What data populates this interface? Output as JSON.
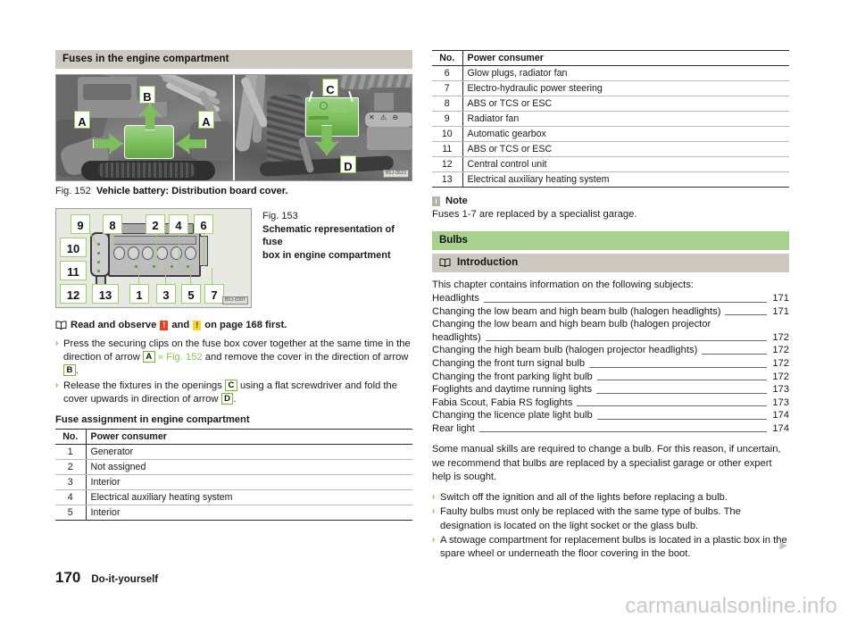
{
  "document": {
    "page_number": "170",
    "section_name": "Do-it-yourself",
    "watermark": "carmanualsonline.info",
    "continuation_marker": "▶"
  },
  "left_column": {
    "section_heading": "Fuses in the engine compartment",
    "figure_152": {
      "label": "Fig. 152",
      "caption": "Vehicle battery: Distribution board cover.",
      "image_code": "B5J-0523",
      "callouts": [
        "A",
        "B",
        "A",
        "C",
        "D"
      ]
    },
    "figure_153": {
      "label": "Fig. 153",
      "caption_line1": "Schematic representation of fuse",
      "caption_line2": "box in engine compartment",
      "image_code": "B5J-0397",
      "top_numbers": [
        "9",
        "8",
        "2",
        "4",
        "6"
      ],
      "left_numbers": [
        "10",
        "11"
      ],
      "bottom_numbers": [
        "12",
        "13",
        "1",
        "3",
        "5",
        "7"
      ]
    },
    "read_observe": {
      "prefix": "Read and observe",
      "middle": "and",
      "suffix": "on page 168 first.",
      "warning_red": "!",
      "warning_yellow": "!",
      "book_icon": "book-icon"
    },
    "bullets": [
      {
        "parts": [
          {
            "type": "text",
            "value": "Press the securing clips on the fuse box cover together at the same time in the direction of arrow "
          },
          {
            "type": "tag",
            "value": "A"
          },
          {
            "type": "xref",
            "value": " » Fig. 152 "
          },
          {
            "type": "text",
            "value": "and remove the cover in the direction of arrow "
          },
          {
            "type": "tag",
            "value": "B"
          },
          {
            "type": "text",
            "value": "."
          }
        ]
      },
      {
        "parts": [
          {
            "type": "text",
            "value": "Release the fixtures in the openings "
          },
          {
            "type": "tag",
            "value": "C"
          },
          {
            "type": "text",
            "value": " using a flat screwdriver and fold the cover upwards in direction of arrow "
          },
          {
            "type": "tag",
            "value": "D"
          },
          {
            "type": "text",
            "value": "."
          }
        ]
      }
    ],
    "table_heading": "Fuse assignment in engine compartment",
    "table": {
      "headers": [
        "No.",
        "Power consumer"
      ],
      "rows": [
        [
          "1",
          "Generator"
        ],
        [
          "2",
          "Not assigned"
        ],
        [
          "3",
          "Interior"
        ],
        [
          "4",
          "Electrical auxiliary heating system"
        ],
        [
          "5",
          "Interior"
        ]
      ]
    }
  },
  "right_column": {
    "table": {
      "headers": [
        "No.",
        "Power consumer"
      ],
      "rows": [
        [
          "6",
          "Glow plugs, radiator fan"
        ],
        [
          "7",
          "Electro-hydraulic power steering"
        ],
        [
          "8",
          "ABS or TCS or ESC"
        ],
        [
          "9",
          "Radiator fan"
        ],
        [
          "10",
          "Automatic gearbox"
        ],
        [
          "11",
          "ABS or TCS or ESC"
        ],
        [
          "12",
          "Central control unit"
        ],
        [
          "13",
          "Electrical auxiliary heating system"
        ]
      ]
    },
    "note": {
      "title": "Note",
      "icon": "info-icon",
      "body": "Fuses 1-7 are replaced by a specialist garage."
    },
    "bulbs_heading": "Bulbs",
    "introduction_heading": "Introduction",
    "introduction_icon": "book-icon",
    "intro_lead": "This chapter contains information on the following subjects:",
    "toc": [
      {
        "title": "Headlights",
        "page": "171",
        "wrap": false
      },
      {
        "title": "Changing the low beam and high beam bulb (halogen headlights)",
        "page": "171",
        "wrap": false
      },
      {
        "title": "Changing the low beam and high beam bulb (halogen projector",
        "title_cont": "headlights)",
        "page": "172",
        "wrap": true
      },
      {
        "title": "Changing the high beam bulb (halogen projector headlights)",
        "page": "172",
        "wrap": false
      },
      {
        "title": "Changing the front turn signal bulb",
        "page": "172",
        "wrap": false
      },
      {
        "title": "Changing the front parking light bulb",
        "page": "172",
        "wrap": false
      },
      {
        "title": "Foglights and daytime running lights",
        "page": "173",
        "wrap": false
      },
      {
        "title": "Fabia Scout, Fabia RS foglights",
        "page": "173",
        "wrap": false
      },
      {
        "title": "Changing the licence plate light bulb",
        "page": "174",
        "wrap": false
      },
      {
        "title": "Rear light",
        "page": "174",
        "wrap": false
      }
    ],
    "paragraph": "Some manual skills are required to change a bulb. For this reason, if uncertain, we recommend that bulbs are replaced by a specialist garage or other expert help is sought.",
    "bullets": [
      "Switch off the ignition and all of the lights before replacing a bulb.",
      "Faulty bulbs must only be replaced with the same type of bulbs. The designation is located on the light socket or the glass bulb.",
      "A stowage compartment for replacement bulbs is located in a plastic box in the spare wheel or underneath the floor covering in the boot."
    ]
  },
  "colors": {
    "heading_grey": "#cdc8c0",
    "heading_green": "#a9d18e",
    "callout_green": "#7dbf5c",
    "bullet_green": "#76b82a",
    "warning_red": "#e8401f",
    "warning_yellow": "#ffd42a",
    "note_icon_grey": "#b6b0a6",
    "watermark_grey": "#c9c9c9"
  }
}
